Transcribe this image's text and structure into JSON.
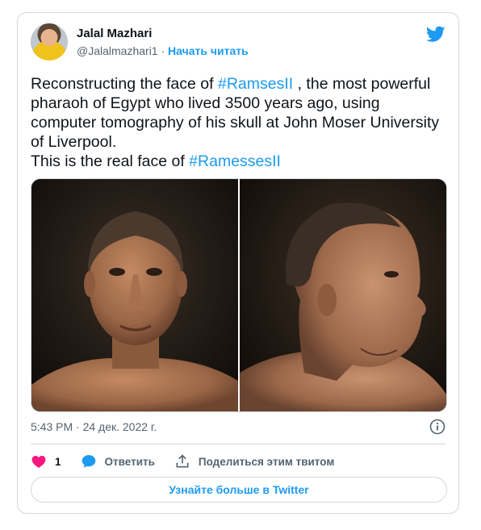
{
  "author": {
    "name": "Jalal Mazhari",
    "handle": "@Jalalmazhari1",
    "separator": "·",
    "follow_label": "Начать читать"
  },
  "tweet": {
    "text_1": "Reconstructing the face of ",
    "hashtag_1": "#RamsesII",
    "text_2": " , the most powerful pharaoh of Egypt who lived 3500 years ago, using computer tomography of his skull at John Moser University of Liverpool.",
    "text_3": "This is the real face of ",
    "hashtag_2": "#RamessesII"
  },
  "timestamp": "5:43 PM · 24 дек. 2022 г.",
  "actions": {
    "like_count": "1",
    "reply_label": "Ответить",
    "share_label": "Поделиться этим твитом"
  },
  "more_button": "Узнайте больше в Twitter",
  "colors": {
    "accent": "#1d9bf0",
    "like": "#f91880",
    "secondary_text": "#536471",
    "border": "#cfd9de"
  },
  "icons": [
    "twitter-bird-icon",
    "info-icon",
    "heart-icon",
    "reply-bubble-icon",
    "share-icon"
  ]
}
